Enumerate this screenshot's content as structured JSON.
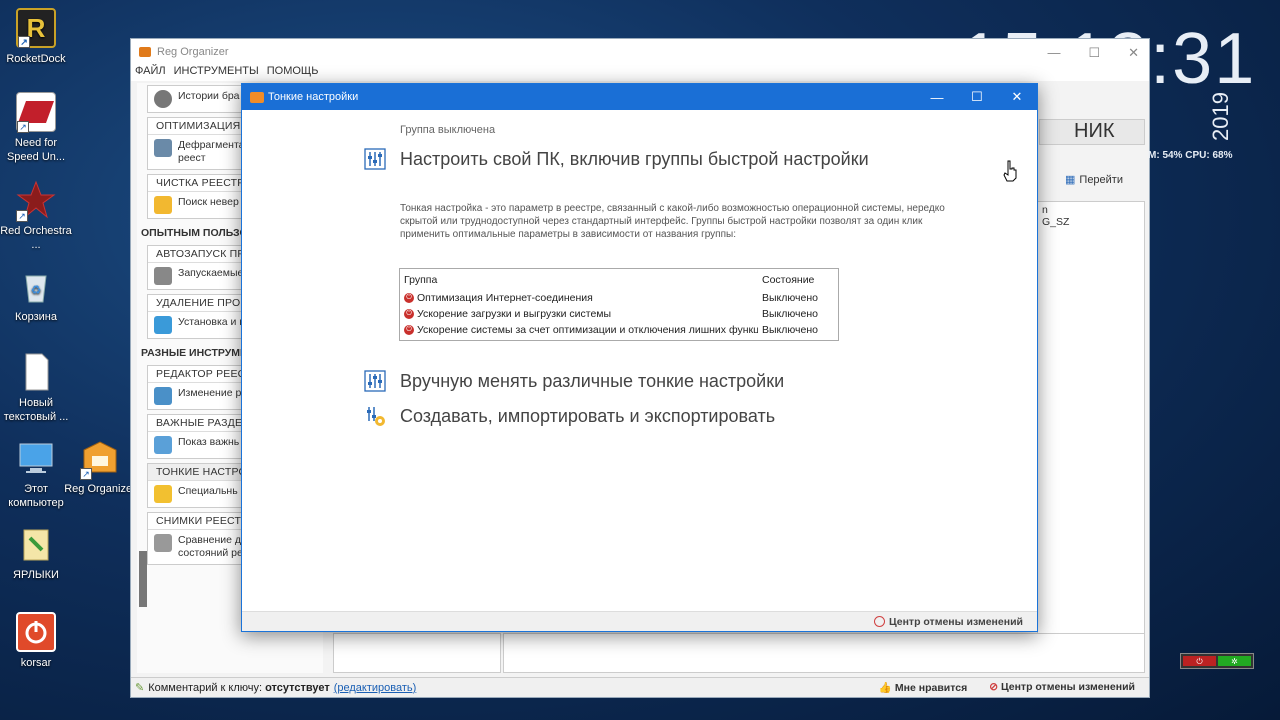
{
  "desktop": {
    "icons": [
      {
        "label": "RocketDock"
      },
      {
        "label": "Need for Speed Un..."
      },
      {
        "label": "Red Orchestra ..."
      },
      {
        "label": "Корзина"
      },
      {
        "label": "Новый текстовый ..."
      },
      {
        "label": "Этот компьютер"
      },
      {
        "label": "Reg Organizer"
      },
      {
        "label": "ЯРЛЫКИ"
      },
      {
        "label": "korsar"
      }
    ],
    "clock": "15:13:31",
    "year": "2019",
    "stats": "M: 54% CPU: 68%"
  },
  "bg_window": {
    "title": "Reg Organizer",
    "menu": [
      "ФАЙЛ",
      "ИНСТРУМЕНТЫ",
      "ПОМОЩЬ"
    ],
    "sections": [
      {
        "head": "",
        "groups": [
          {
            "title": "",
            "text": "Истории бра кэша програ"
          },
          {
            "title": "ОПТИМИЗАЦИЯ Р",
            "text": "Дефрагмента сжатие реест"
          },
          {
            "title": "ЧИСТКА РЕЕСТРА",
            "text": "Поиск невер в реестре"
          }
        ]
      },
      {
        "head": "ОПЫТНЫМ ПОЛЬЗО",
        "groups": [
          {
            "title": "АВТОЗАПУСК ПРО",
            "text": "Запускаемые системой пр"
          },
          {
            "title": "УДАЛЕНИЕ ПРОГР",
            "text": "Установка и программ"
          }
        ]
      },
      {
        "head": "РАЗНЫЕ ИНСТРУМЕ",
        "groups": [
          {
            "title": "РЕДАКТОР РЕЕСТР",
            "text": "Изменение р поиск в нем"
          },
          {
            "title": "ВАЖНЫЕ РАЗДЕЛ",
            "text": "Показ важнь реестра"
          },
          {
            "title": "ТОНКИЕ НАСТРОЙ",
            "text": "Специальнь системы"
          },
          {
            "title": "СНИМКИ РЕЕСТРА",
            "text": "Сравнение двух состояний реестра"
          }
        ]
      }
    ],
    "right_header": "НИК",
    "goto_label": "Перейти",
    "list_items": [
      "n",
      "G_SZ"
    ],
    "status": {
      "prefix": "Комментарий к ключу:",
      "value": "отсутствует",
      "link": "(редактировать)",
      "like": "Мне нравится",
      "undo": "Центр отмены изменений"
    }
  },
  "dialog": {
    "title": "Тонкие настройки",
    "group_status": "Группа выключена",
    "heading1": "Настроить свой ПК, включив группы быстрой настройки",
    "description": "Тонкая настройка - это параметр в реестре, связанный с какой-либо возможностью операционной системы, нередко скрытой или труднодоступной через стандартный интерфейс. Группы быстрой настройки позволят за один клик применить оптимальные параметры в зависимости от названия группы:",
    "table": {
      "headers": [
        "Группа",
        "Состояние"
      ],
      "rows": [
        {
          "name": "Оптимизация Интернет-соединения",
          "state": "Выключено"
        },
        {
          "name": "Ускорение загрузки и выгрузки системы",
          "state": "Выключено"
        },
        {
          "name": "Ускорение системы за счет оптимизации и отключения лишних функц...",
          "state": "Выключено"
        }
      ]
    },
    "heading2": "Вручную менять различные тонкие настройки",
    "heading3": "Создавать, импортировать и экспортировать",
    "footer_undo": "Центр отмены изменений"
  },
  "colors": {
    "accent": "#1a6fd6",
    "power_red": "#c9302c"
  }
}
